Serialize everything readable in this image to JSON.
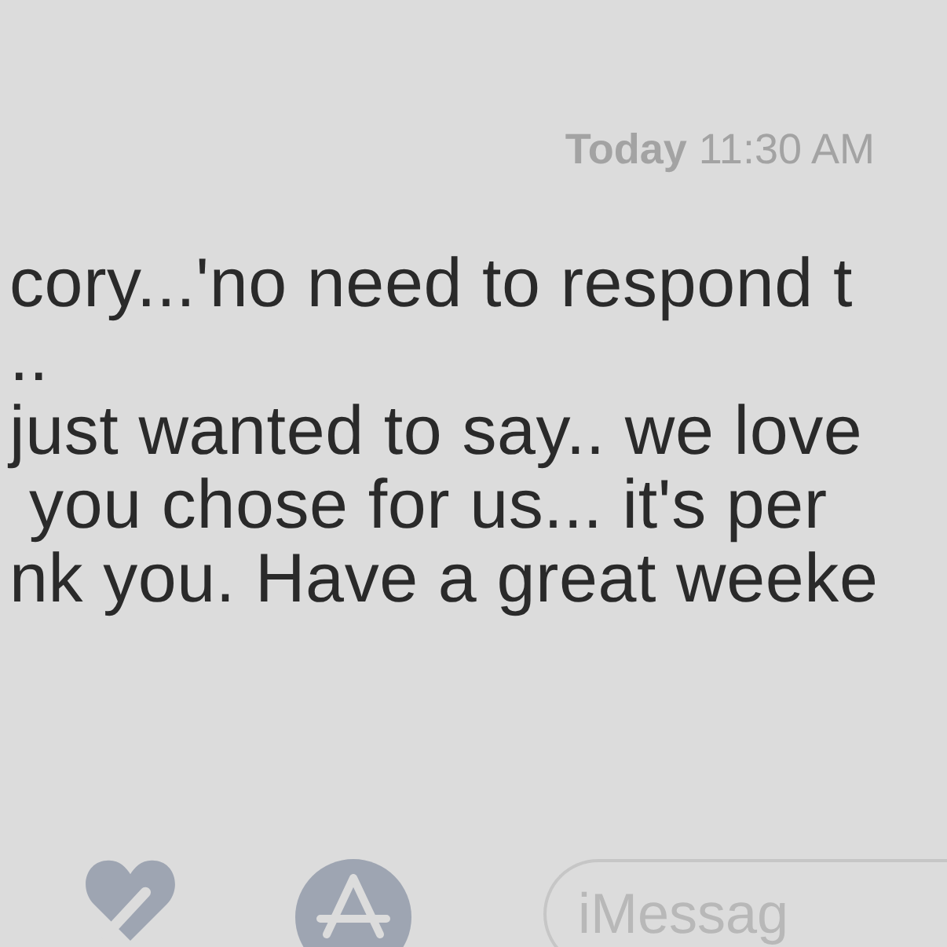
{
  "timestamp": {
    "day": "Today",
    "time": "11:30 AM"
  },
  "message": {
    "lines": [
      "cory...'no need to respond t",
      "..",
      "just wanted to say.. we love",
      " you chose for us... it's per",
      "nk you. Have a great weeke"
    ]
  },
  "compose": {
    "placeholder": "iMessag"
  }
}
